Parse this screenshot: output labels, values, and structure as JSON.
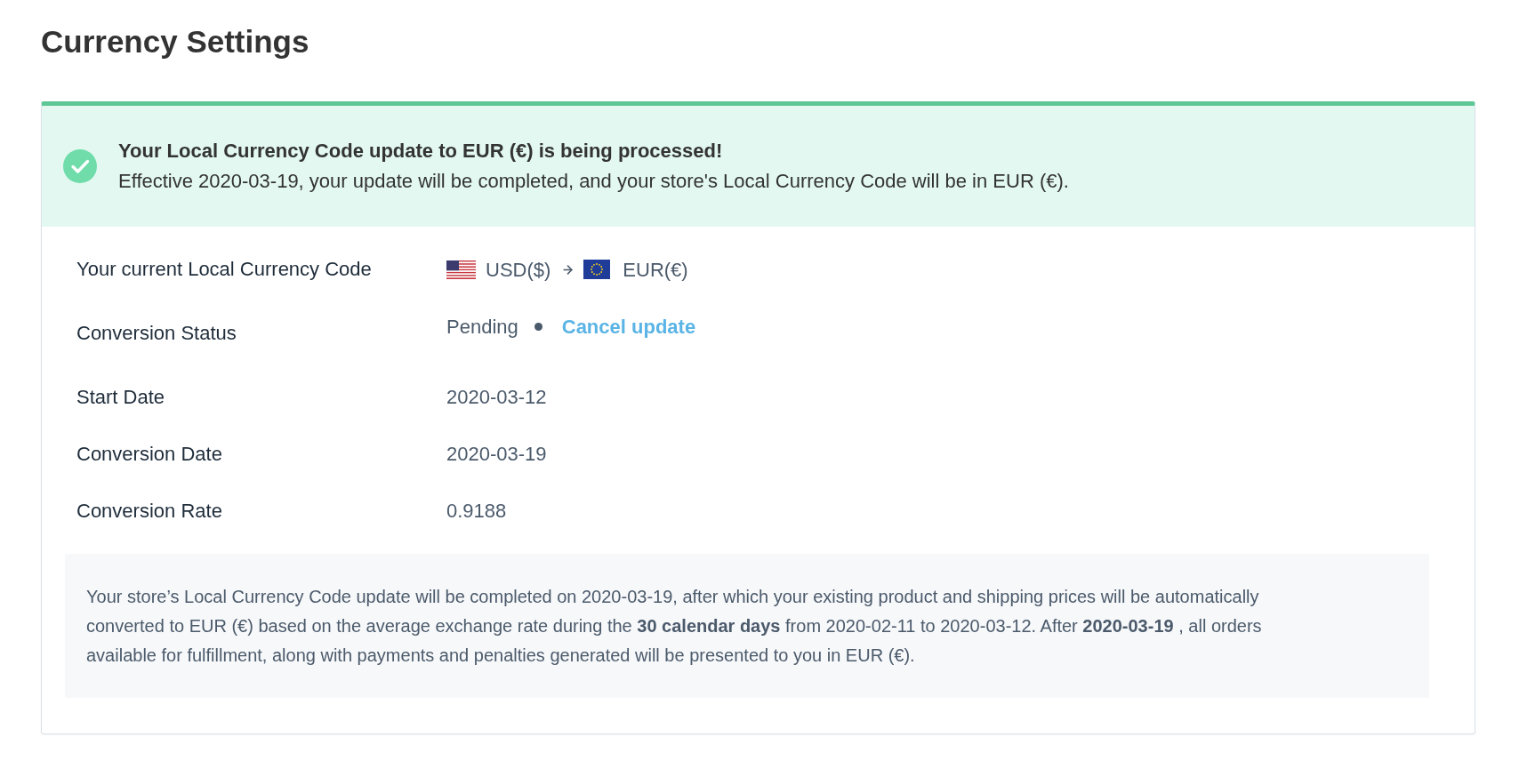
{
  "page": {
    "title": "Currency Settings"
  },
  "banner": {
    "kind": "success",
    "title": "Your Local Currency Code update to EUR (€) is being processed!",
    "message": "Effective 2020-03-19, your update will be completed, and your store's Local Currency Code will be in EUR (€)."
  },
  "details": [
    {
      "kind": "currency",
      "label": "Your current Local Currency Code",
      "from": "USD($)",
      "to": "EUR(€)"
    },
    {
      "kind": "status",
      "label": "Conversion Status",
      "value": "Pending",
      "action": "Cancel update"
    },
    {
      "kind": "text",
      "label": "Start Date",
      "value": "2020-03-12"
    },
    {
      "kind": "text",
      "label": "Conversion Date",
      "value": "2020-03-19"
    },
    {
      "kind": "text",
      "label": "Conversion Rate",
      "value": "0.9188"
    }
  ],
  "note": "Your store’s Local Currency Code update will be completed on 2020-03-19, after which your existing product and shipping prices will be automatically converted to EUR (€) based on the average exchange rate during the **30 calendar days** from 2020-02-11 to 2020-03-12. After **2020-03-19** , all orders available for fulfillment, along with payments and penalties generated will be presented to you in EUR (€)."
}
